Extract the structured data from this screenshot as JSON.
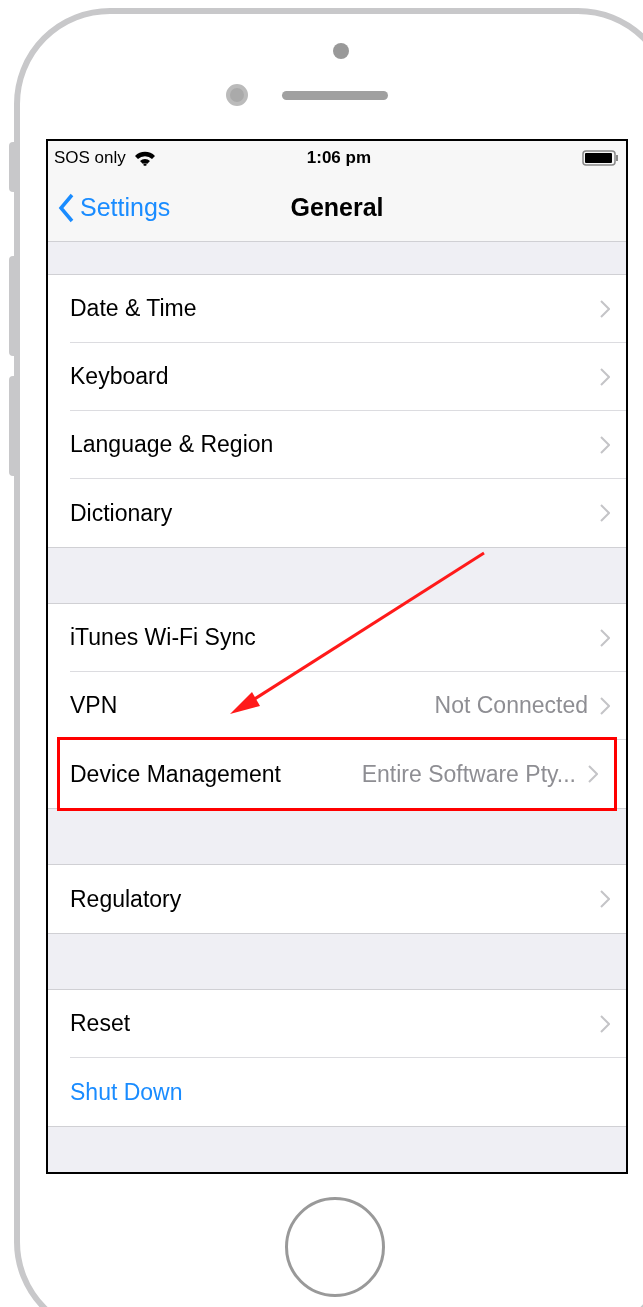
{
  "status_bar": {
    "carrier": "SOS only",
    "time": "1:06 pm"
  },
  "nav": {
    "back": "Settings",
    "title": "General"
  },
  "groups": [
    {
      "rows": [
        {
          "label": "Date & Time",
          "highlighted": false
        },
        {
          "label": "Keyboard",
          "highlighted": false
        },
        {
          "label": "Language & Region",
          "highlighted": false
        },
        {
          "label": "Dictionary",
          "highlighted": false
        }
      ]
    },
    {
      "rows": [
        {
          "label": "iTunes Wi-Fi Sync",
          "highlighted": false
        },
        {
          "label": "VPN",
          "detail": "Not Connected",
          "highlighted": false
        },
        {
          "label": "Device Management",
          "detail": "Entire Software Pty...",
          "highlighted": true
        }
      ]
    },
    {
      "rows": [
        {
          "label": "Regulatory",
          "highlighted": false
        }
      ]
    },
    {
      "rows": [
        {
          "label": "Reset",
          "highlighted": false
        },
        {
          "label": "Shut Down",
          "kind": "action",
          "highlighted": false
        }
      ]
    }
  ]
}
